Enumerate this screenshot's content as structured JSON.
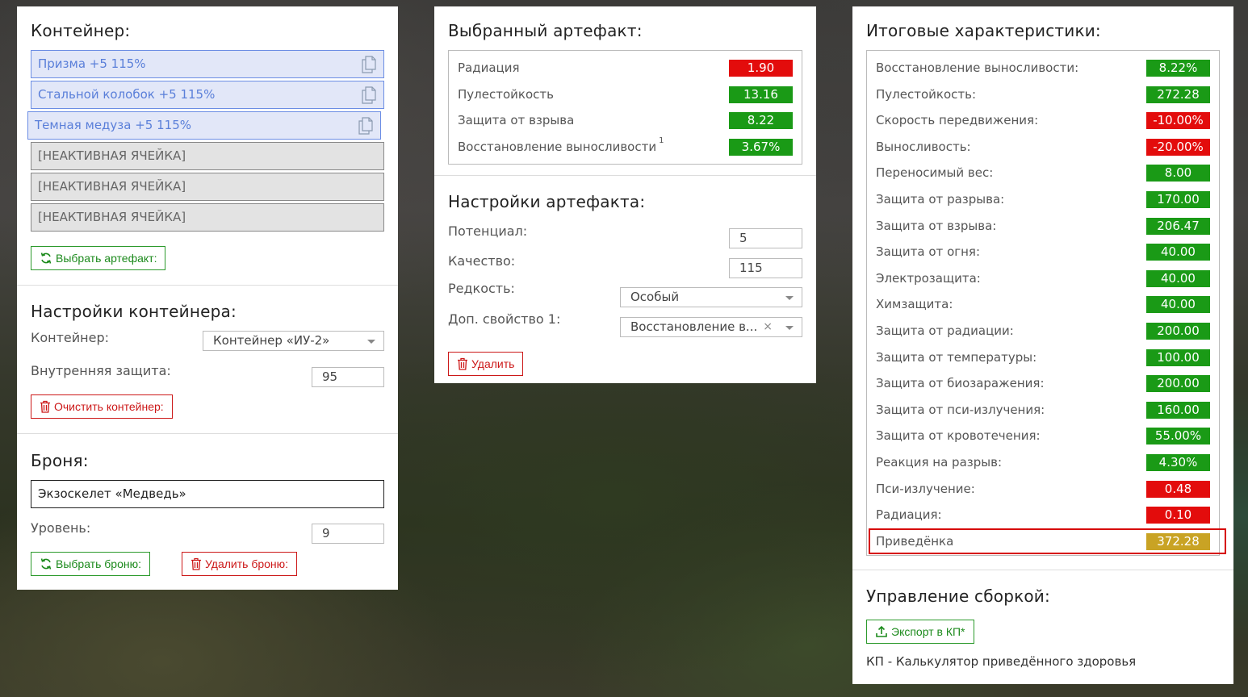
{
  "container": {
    "title": "Контейнер:",
    "slots": [
      {
        "label": "Призма +5 115%",
        "state": "active"
      },
      {
        "label": "Стальной колобок +5 115%",
        "state": "active"
      },
      {
        "label": "Темная медуза +5 115%",
        "state": "active"
      },
      {
        "label": "[НЕАКТИВНАЯ ЯЧЕЙКА]",
        "state": "inactive"
      },
      {
        "label": "[НЕАКТИВНАЯ ЯЧЕЙКА]",
        "state": "inactive"
      },
      {
        "label": "[НЕАКТИВНАЯ ЯЧЕЙКА]",
        "state": "inactive"
      }
    ],
    "select_artifact_button": "Выбрать артефакт:"
  },
  "container_settings": {
    "title": "Настройки контейнера:",
    "container_label": "Контейнер:",
    "container_value": "Контейнер «ИУ-2»",
    "inner_protection_label": "Внутренняя защита:",
    "inner_protection_value": "95",
    "clear_button": "Очистить контейнер:"
  },
  "armor": {
    "title": "Броня:",
    "name": "Экзоскелет «Медведь»",
    "level_label": "Уровень:",
    "level_value": "9",
    "select_button": "Выбрать броню:",
    "delete_button": "Удалить броню:"
  },
  "selected_artifact": {
    "title": "Выбранный артефакт:",
    "stats": [
      {
        "label": "Радиация",
        "value": "1.90",
        "color": "red"
      },
      {
        "label": "Пулестойкость",
        "value": "13.16",
        "color": "green"
      },
      {
        "label": "Защита от взрыва",
        "value": "8.22",
        "color": "green"
      },
      {
        "label": "Восстановление выносливости",
        "sup": "1",
        "value": "3.67%",
        "color": "green"
      }
    ]
  },
  "artifact_settings": {
    "title": "Настройки артефакта:",
    "potential_label": "Потенциал:",
    "potential_value": "5",
    "quality_label": "Качество:",
    "quality_value": "115",
    "rarity_label": "Редкость:",
    "rarity_value": "Особый",
    "extra_label": "Доп. свойство 1:",
    "extra_value": "Восстановление в...",
    "extra_clear": "×",
    "delete_button": "Удалить"
  },
  "totals": {
    "title": "Итоговые характеристики:",
    "stats": [
      {
        "label": "Восстановление выносливости:",
        "value": "8.22%",
        "color": "green"
      },
      {
        "label": "Пулестойкость:",
        "value": "272.28",
        "color": "green"
      },
      {
        "label": "Скорость передвижения:",
        "value": "-10.00%",
        "color": "red"
      },
      {
        "label": "Выносливость:",
        "value": "-20.00%",
        "color": "red"
      },
      {
        "label": "Переносимый вес:",
        "value": "8.00",
        "color": "green"
      },
      {
        "label": "Защита от разрыва:",
        "value": "170.00",
        "color": "green"
      },
      {
        "label": "Защита от взрыва:",
        "value": "206.47",
        "color": "green"
      },
      {
        "label": "Защита от огня:",
        "value": "40.00",
        "color": "green"
      },
      {
        "label": "Электрозащита:",
        "value": "40.00",
        "color": "green"
      },
      {
        "label": "Химзащита:",
        "value": "40.00",
        "color": "green"
      },
      {
        "label": "Защита от радиации:",
        "value": "200.00",
        "color": "green"
      },
      {
        "label": "Защита от температуры:",
        "value": "100.00",
        "color": "green"
      },
      {
        "label": "Защита от биозаражения:",
        "value": "200.00",
        "color": "green"
      },
      {
        "label": "Защита от пси-излучения:",
        "value": "160.00",
        "color": "green"
      },
      {
        "label": "Защита от кровотечения:",
        "value": "55.00%",
        "color": "green"
      },
      {
        "label": "Реакция на разрыв:",
        "value": "4.30%",
        "color": "green"
      },
      {
        "label": "Пси-излучение:",
        "value": "0.48",
        "color": "red"
      },
      {
        "label": "Радиация:",
        "value": "0.10",
        "color": "red"
      },
      {
        "label": "Приведёнка",
        "value": "372.28",
        "color": "gold"
      }
    ]
  },
  "build_management": {
    "title": "Управление сборкой:",
    "export_button": "Экспорт в КП*",
    "footnote": "КП - Калькулятор приведённого здоровья"
  },
  "colors": {
    "green": "#1a9a16",
    "red": "#e30c0c",
    "gold": "#c9a324",
    "slot_active_bg": "#e2e7f8",
    "slot_active_text": "#5a7fd9"
  }
}
